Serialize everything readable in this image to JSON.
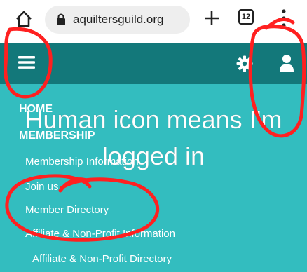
{
  "browser": {
    "url": "aquiltersguild.org",
    "tab_count": "12"
  },
  "nav": {
    "items": [
      {
        "label": "HOME"
      },
      {
        "label": "MEMBERSHIP"
      },
      {
        "label": "Membership Information"
      },
      {
        "label": "Join us"
      },
      {
        "label": "Member Directory"
      },
      {
        "label": "Affiliate & Non-Profit Information"
      },
      {
        "label": "Affiliate & Non-Profit Directory"
      }
    ]
  },
  "annotation": {
    "caption_line1": "Human icon means I'm",
    "caption_line2": "logged in",
    "ink_color": "#ff2020"
  },
  "colors": {
    "nav_bar": "#13787a",
    "menu_bg": "#33bdbf",
    "menu_text": "#ffffff"
  },
  "icons": [
    "home-icon",
    "lock-icon",
    "plus-icon",
    "tabs-icon",
    "kebab-icon",
    "hamburger-icon",
    "gear-icon",
    "user-icon"
  ]
}
